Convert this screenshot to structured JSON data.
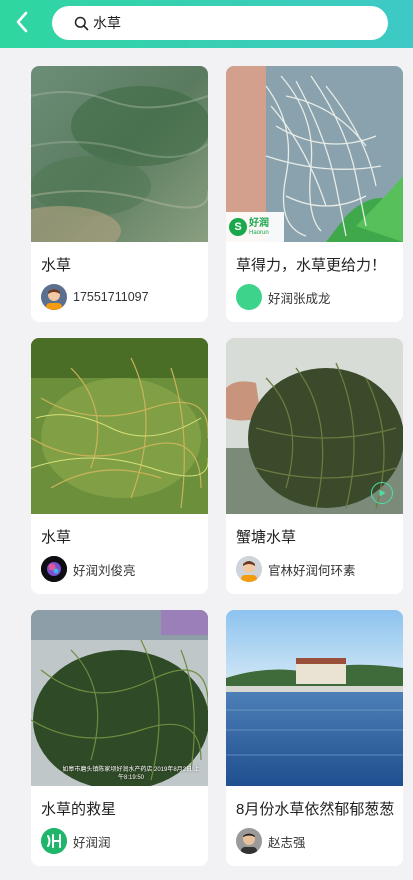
{
  "header": {
    "search_value": "水草",
    "accent_start": "#2fd6a0",
    "accent_end": "#3fc9c6"
  },
  "cards": [
    {
      "title": "水草",
      "author": "17551711097",
      "avatar": "person-avatar"
    },
    {
      "title": "草得力，水草更给力！",
      "author": "好润张成龙",
      "avatar": "green-circle-avatar",
      "logo_cn": "好润",
      "logo_en": "Haorun"
    },
    {
      "title": "水草",
      "author": "好润刘俊亮",
      "avatar": "dark-photo-avatar"
    },
    {
      "title": "蟹塘水草",
      "author": "官林好润何环素",
      "avatar": "person-avatar",
      "video": true
    },
    {
      "title": "水草的救星",
      "author": "好润润",
      "avatar": "haorun-logo-avatar",
      "stamp": "如皋市磨头镇陈家坝好润水产药店 2019年8月2日 上午8:19:50"
    },
    {
      "title": "8月份水草依然郁郁葱葱",
      "author": "赵志强",
      "avatar": "person-photo-avatar"
    }
  ]
}
